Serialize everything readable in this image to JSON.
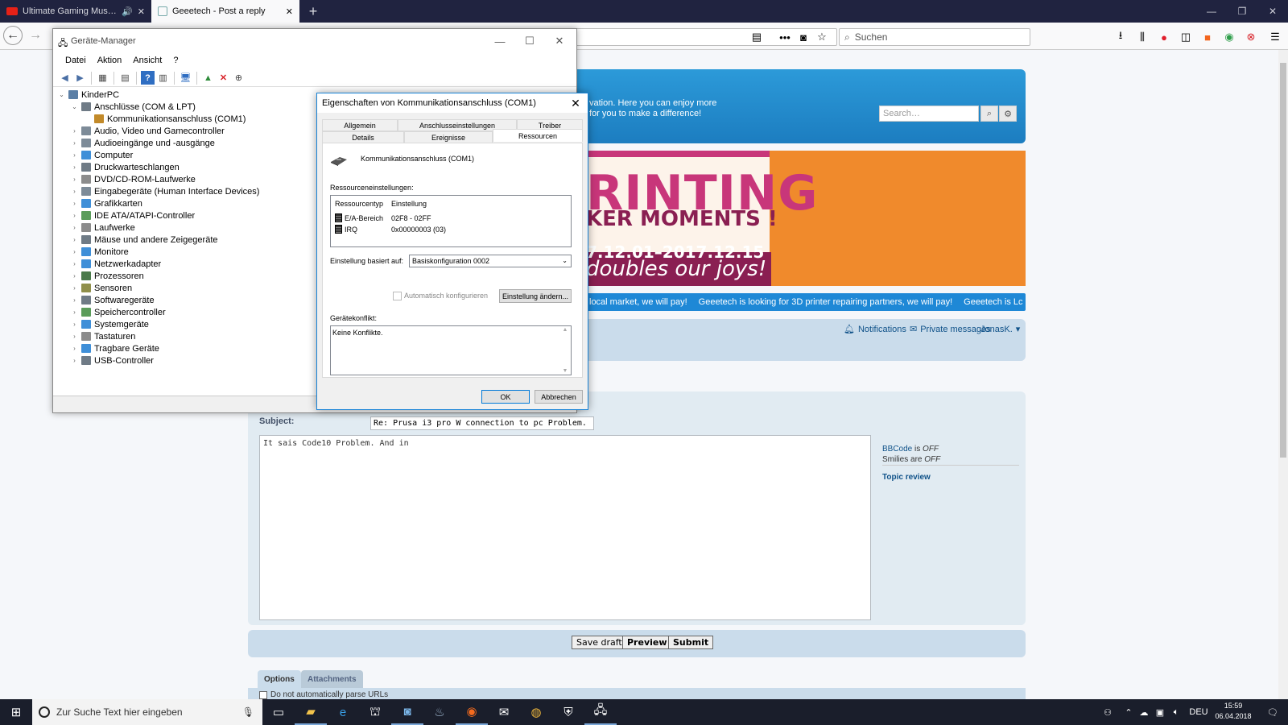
{
  "browser": {
    "tabs": [
      {
        "label": "Ultimate Gaming Music Mi",
        "active": false,
        "audio": true
      },
      {
        "label": "Geeetech - Post a reply",
        "active": true
      }
    ],
    "new_tab": "+",
    "search_placeholder": "Suchen"
  },
  "forum": {
    "header_line1": "vation. Here you can enjoy more",
    "header_line2": "for you to make a difference!",
    "search_placeholder": "Search…",
    "banner": {
      "line1": "RINTING",
      "line2": "KER MOMENTS !",
      "line3": "7.12.01–2017.12.15",
      "line4": "doubles our joys!"
    },
    "ticker": [
      "local market, we will pay!",
      "Geeetech is looking for 3D printer repairing partners, we will pay!",
      "Geeetech is Lc"
    ],
    "nav": {
      "notifications": "Notifications",
      "private_messages": "Private messages",
      "user": "JonasK."
    },
    "subject_label": "Subject:",
    "subject_value": "Re: Prusa i3 pro W connection to pc Problem.",
    "message": "It sais Code10 Problem. And in",
    "side": {
      "bbcode": "BBCode",
      "is": "is",
      "off": "OFF",
      "smilies": "Smilies are",
      "topic_review": "Topic review"
    },
    "buttons": {
      "save_draft": "Save draft",
      "preview": "Preview",
      "submit": "Submit"
    },
    "tabs": {
      "options": "Options",
      "attachments": "Attachments"
    },
    "option1": "Do not automatically parse URLs"
  },
  "device_manager": {
    "title": "Geräte-Manager",
    "menu": [
      "Datei",
      "Aktion",
      "Ansicht",
      "?"
    ],
    "tree": [
      {
        "label": "KinderPC",
        "level": 0,
        "expanded": true,
        "color": "#5b7fa6"
      },
      {
        "label": "Anschlüsse (COM & LPT)",
        "level": 1,
        "expanded": true,
        "color": "#6f7b86"
      },
      {
        "label": "Kommunikationsanschluss (COM1)",
        "level": 2,
        "expanded": null,
        "color": "#c28a2a"
      },
      {
        "label": "Audio, Video und Gamecontroller",
        "level": 1,
        "expanded": false,
        "color": "#7d8b98"
      },
      {
        "label": "Audioeingänge und -ausgänge",
        "level": 1,
        "expanded": false,
        "color": "#7d8b98"
      },
      {
        "label": "Computer",
        "level": 1,
        "expanded": false,
        "color": "#3f8fd8"
      },
      {
        "label": "Druckwarteschlangen",
        "level": 1,
        "expanded": false,
        "color": "#6f7b86"
      },
      {
        "label": "DVD/CD-ROM-Laufwerke",
        "level": 1,
        "expanded": false,
        "color": "#8c8c8c"
      },
      {
        "label": "Eingabegeräte (Human Interface Devices)",
        "level": 1,
        "expanded": false,
        "color": "#7d8b98"
      },
      {
        "label": "Grafikkarten",
        "level": 1,
        "expanded": false,
        "color": "#3f8fd8"
      },
      {
        "label": "IDE ATA/ATAPI-Controller",
        "level": 1,
        "expanded": false,
        "color": "#5a9c5a"
      },
      {
        "label": "Laufwerke",
        "level": 1,
        "expanded": false,
        "color": "#8c8c8c"
      },
      {
        "label": "Mäuse und andere Zeigegeräte",
        "level": 1,
        "expanded": false,
        "color": "#6f7b86"
      },
      {
        "label": "Monitore",
        "level": 1,
        "expanded": false,
        "color": "#3f8fd8"
      },
      {
        "label": "Netzwerkadapter",
        "level": 1,
        "expanded": false,
        "color": "#3f8fd8"
      },
      {
        "label": "Prozessoren",
        "level": 1,
        "expanded": false,
        "color": "#4a7a4a"
      },
      {
        "label": "Sensoren",
        "level": 1,
        "expanded": false,
        "color": "#8f8f4a"
      },
      {
        "label": "Softwaregeräte",
        "level": 1,
        "expanded": false,
        "color": "#6f7b86"
      },
      {
        "label": "Speichercontroller",
        "level": 1,
        "expanded": false,
        "color": "#5a9c5a"
      },
      {
        "label": "Systemgeräte",
        "level": 1,
        "expanded": false,
        "color": "#3f8fd8"
      },
      {
        "label": "Tastaturen",
        "level": 1,
        "expanded": false,
        "color": "#8c8c8c"
      },
      {
        "label": "Tragbare Geräte",
        "level": 1,
        "expanded": false,
        "color": "#3f8fd8"
      },
      {
        "label": "USB-Controller",
        "level": 1,
        "expanded": false,
        "color": "#6f7b86"
      }
    ]
  },
  "dialog": {
    "title": "Eigenschaften von Kommunikationsanschluss (COM1)",
    "tabs_row1": [
      "Allgemein",
      "Anschlusseinstellungen",
      "Treiber"
    ],
    "tabs_row2": [
      "Details",
      "Ereignisse",
      "Ressourcen"
    ],
    "selected_tab": "Ressourcen",
    "device_name": "Kommunikationsanschluss (COM1)",
    "resources_label": "Ressourceneinstellungen:",
    "col_type": "Ressourcentyp",
    "col_setting": "Einstellung",
    "resources": [
      {
        "type": "E/A-Bereich",
        "setting": "02F8 - 02FF"
      },
      {
        "type": "IRQ",
        "setting": "0x00000003 (03)"
      }
    ],
    "based_on_label": "Einstellung basiert auf:",
    "based_on_value": "Basiskonfiguration 0002",
    "auto_config": "Automatisch konfigurieren",
    "change_button": "Einstellung ändern...",
    "conflict_label": "Gerätekonflikt:",
    "conflict_value": "Keine Konflikte.",
    "ok": "OK",
    "cancel": "Abbrechen"
  },
  "taskbar": {
    "search_placeholder": "Zur Suche Text hier eingeben",
    "language": "DEU",
    "time": "15:59",
    "date": "06.04.2018"
  },
  "colors": {
    "forum_blue": "#1e88d6",
    "banner_pink": "#c8367a",
    "banner_orange": "#f08a2c",
    "dialog_border": "#1883d7"
  }
}
